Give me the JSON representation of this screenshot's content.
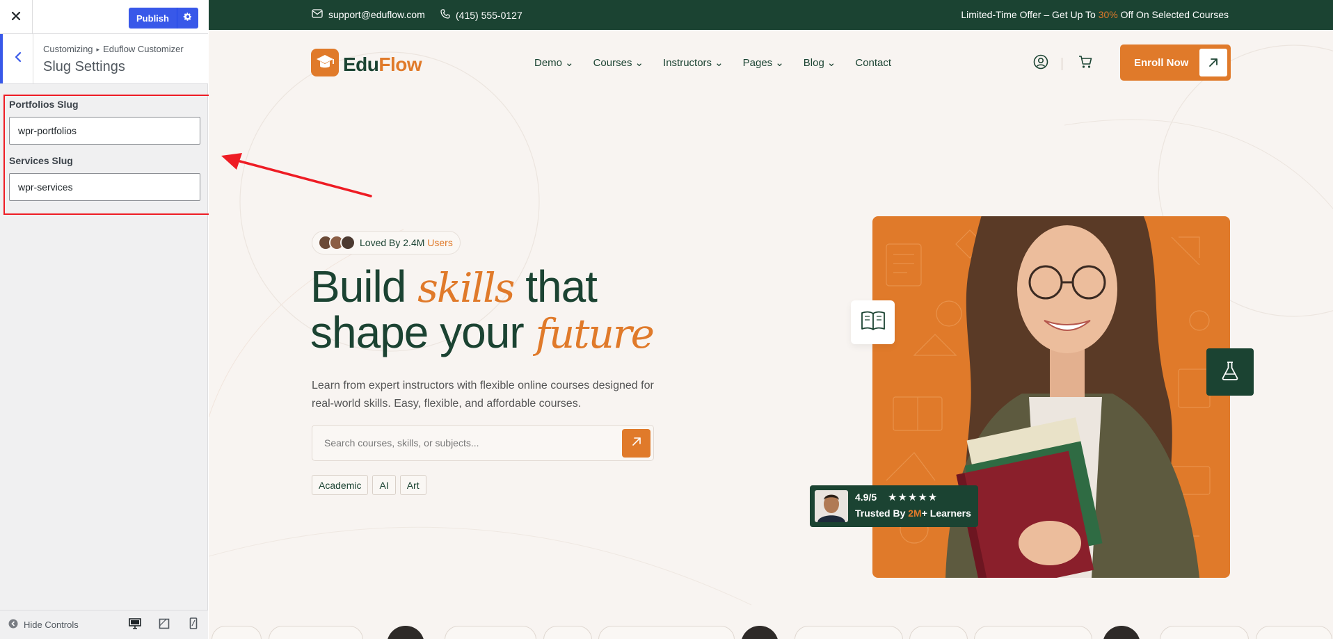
{
  "sidebar": {
    "close_icon": "close-icon",
    "publish_label": "Publish",
    "breadcrumb": {
      "root": "Customizing",
      "child": "Eduflow Customizer"
    },
    "section_title": "Slug Settings",
    "fields": [
      {
        "label": "Portfolios Slug",
        "value": "wpr-portfolios"
      },
      {
        "label": "Services Slug",
        "value": "wpr-services"
      }
    ],
    "footer": {
      "hide_controls_label": "Hide Controls",
      "devices": [
        "desktop-icon",
        "tablet-icon",
        "mobile-icon"
      ]
    }
  },
  "site": {
    "topbar": {
      "email": "support@eduflow.com",
      "phone": "(415) 555-0127",
      "offer_prefix": "Limited-Time Offer – Get Up To ",
      "offer_highlight": "30%",
      "offer_suffix": " Off On Selected Courses"
    },
    "logo": {
      "part1": "Edu",
      "part2": "Flow"
    },
    "menu": [
      "Demo",
      "Courses",
      "Instructors",
      "Pages",
      "Blog",
      "Contact"
    ],
    "enroll_label": "Enroll Now",
    "hero": {
      "loved_prefix": "Loved By 2.4M ",
      "loved_highlight": "Users",
      "headline": {
        "w1": "Build ",
        "w2": "skills",
        "w3": " that",
        "w4": "shape your ",
        "w5": "future"
      },
      "lead": "Learn from expert instructors with flexible online courses designed for real-world skills. Easy, flexible, and affordable courses.",
      "search_placeholder": "Search courses, skills, or subjects...",
      "tags": [
        "Academic",
        "AI",
        "Art"
      ],
      "rating": {
        "score": "4.9/5",
        "stars": "★★★★★",
        "trust_prefix": "Trusted By ",
        "trust_highlight": "2M",
        "trust_suffix": "+ Learners"
      }
    }
  },
  "colors": {
    "brand_green": "#1b4332",
    "brand_orange": "#e07a2a",
    "wp_blue": "#3858e9",
    "annotation_red": "#ee1c24"
  }
}
